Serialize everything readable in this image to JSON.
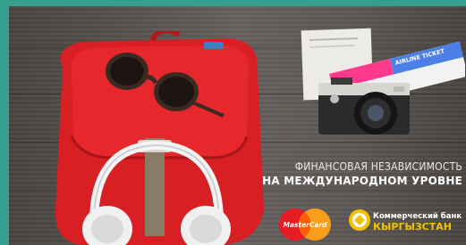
{
  "tagline": {
    "line1": "ФИНАНСОВАЯ НЕЗАВИСИМОСТЬ",
    "line2": "НА МЕЖДУНАРОДНОМ УРОВНЕ"
  },
  "ticket": {
    "label": "AIRLINE TICKET"
  },
  "mastercard": {
    "label": "MasterCard"
  },
  "bank": {
    "line1": "Коммерческий банк",
    "line2": "КЫРГЫЗСТАН"
  },
  "colors": {
    "frame": "#36a08f",
    "backpack": "#e0262a",
    "bank_yellow": "#f2c200"
  },
  "icons": [
    "sunglasses-icon",
    "headphones-icon",
    "camera-icon",
    "mastercard-logo",
    "bank-logo"
  ]
}
